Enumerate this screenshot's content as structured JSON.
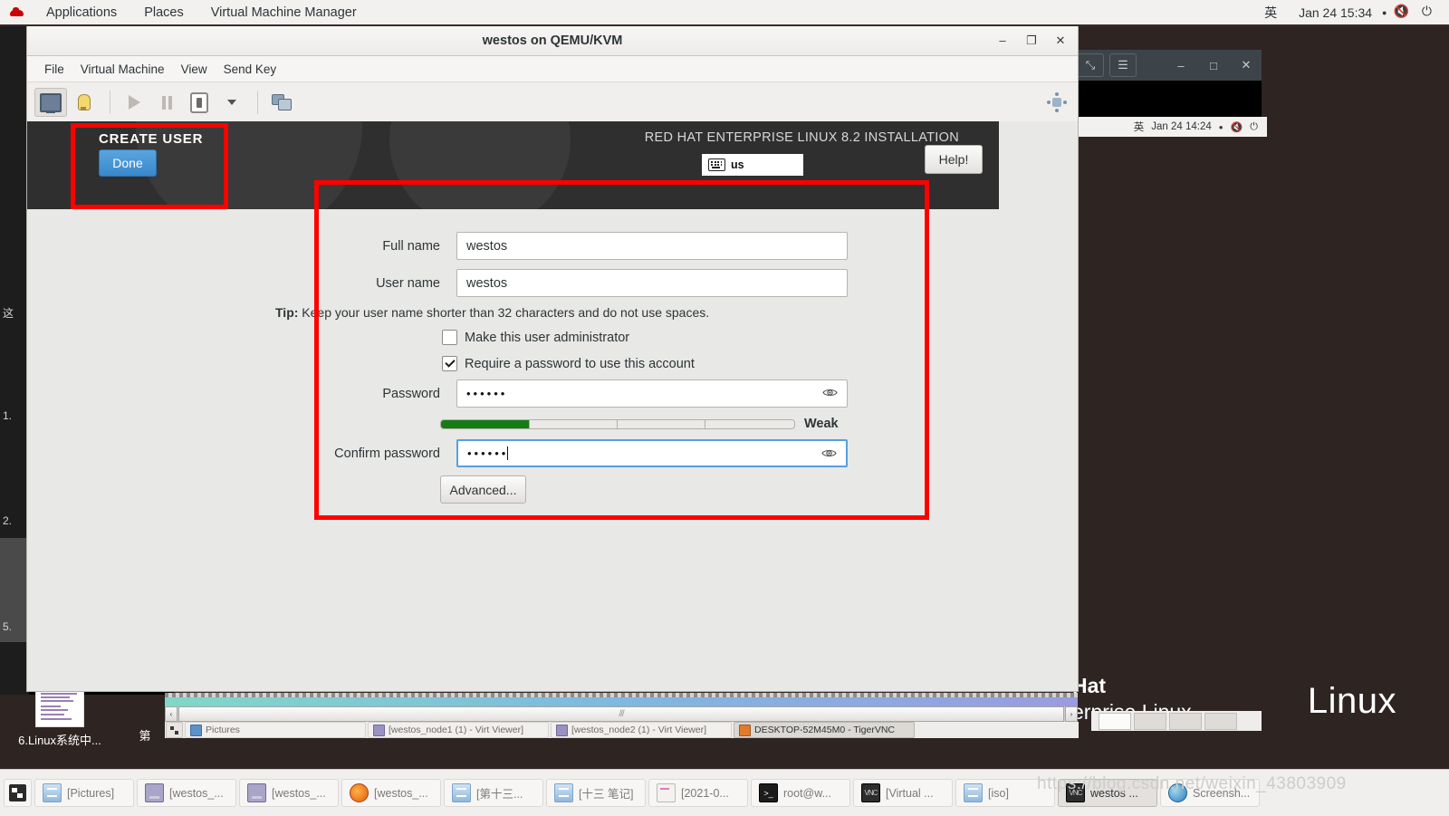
{
  "gnome_topbar": {
    "logo_icon": "red-hat-logo-icon",
    "items": [
      "Applications",
      "Places",
      "Virtual Machine Manager"
    ],
    "ime": "英",
    "clock": "Jan 24  15:34",
    "clock_dot": "●",
    "volume_icon": "volume-muted-icon",
    "power_icon": "power-icon"
  },
  "background_window": {
    "buttons": [
      "fullscreen-icon",
      "menu-icon",
      "minimize-icon",
      "maximize-icon",
      "close-icon"
    ],
    "fullscreen_glyph": "⤡",
    "menu_glyph": "☰",
    "minimize_glyph": "–",
    "maximize_glyph": "□",
    "close_glyph": "✕",
    "gnome_ime": "英",
    "gnome_clock": "Jan 24 14:24",
    "gnome_dot": "●",
    "gnome_volume": "🔇",
    "gnome_power": "⏻",
    "brand_line1": "Hat",
    "brand_line2": "erprise Linux"
  },
  "desktop": {
    "wallpaper_text": "Linux",
    "icons": [
      {
        "label": "6.Linux系统中..."
      },
      {
        "label": "第"
      }
    ]
  },
  "left_doc_panel": {
    "rows": [
      "这",
      "1.",
      "2.",
      "5."
    ]
  },
  "vm_window": {
    "title": "westos on QEMU/KVM",
    "window_buttons": {
      "minimize": "–",
      "maximize": "❐",
      "close": "✕"
    },
    "menus": [
      "File",
      "Virtual Machine",
      "View",
      "Send Key"
    ],
    "toolbar": [
      {
        "name": "console-view-button",
        "icon": "monitor-icon"
      },
      {
        "name": "details-view-button",
        "icon": "lightbulb-icon"
      },
      {
        "name": "run-button",
        "icon": "play-icon"
      },
      {
        "name": "pause-button",
        "icon": "pause-icon"
      },
      {
        "name": "shutdown-button",
        "icon": "power-off-icon"
      },
      {
        "name": "shutdown-menu-button",
        "icon": "chevron-down-icon"
      },
      {
        "name": "snapshots-button",
        "icon": "screens-icon"
      },
      {
        "name": "fullscreen-toggle",
        "icon": "expand-dots-icon"
      }
    ]
  },
  "installer": {
    "spoke_title": "CREATE USER",
    "done_label": "Done",
    "product_title": "RED HAT ENTERPRISE LINUX 8.2 INSTALLATION",
    "keyboard_layout": "us",
    "keyboard_icon": "keyboard-icon",
    "help_label": "Help!",
    "fields": {
      "full_name_label": "Full name",
      "full_name_value": "westos",
      "user_name_label": "User name",
      "user_name_value": "westos",
      "tip_bold": "Tip:",
      "tip_text": " Keep your user name shorter than 32 characters and do not use spaces.",
      "admin_checkbox_label": "Make this user administrator",
      "admin_checked": false,
      "require_password_label": "Require a password to use this account",
      "require_password_checked": true,
      "password_label": "Password",
      "password_value": "••••••",
      "confirm_label": "Confirm password",
      "confirm_value": "••••••",
      "reveal_icon": "eye-icon",
      "strength_label": "Weak",
      "strength_percent": 25,
      "strength_color": "#157c15",
      "advanced_label": "Advanced..."
    }
  },
  "inner_taskbar": {
    "start_icon": "show-desktop-icon",
    "items": [
      {
        "label": "Pictures",
        "icon": "folder-icon",
        "selected": false
      },
      {
        "label": "[westos_node1 (1) - Virt Viewer]",
        "icon": "viewer-icon",
        "selected": false
      },
      {
        "label": "[westos_node2 (1) - Virt Viewer]",
        "icon": "viewer-icon",
        "selected": false
      },
      {
        "label": "DESKTOP-52M45M0 - TigerVNC",
        "icon": "vnc-icon",
        "selected": true
      }
    ],
    "scroll_thumb_glyph": "///",
    "scroll_left_glyph": "‹",
    "scroll_right_glyph": "›"
  },
  "windows_taskbar": {
    "show_desktop_icon": "show-desktop-icon",
    "items": [
      {
        "label": "[Pictures]",
        "icon": "drive-icon",
        "selected": false
      },
      {
        "label": "[westos_...",
        "icon": "monitor-icon",
        "selected": false
      },
      {
        "label": "[westos_...",
        "icon": "monitor-icon",
        "selected": false
      },
      {
        "label": "[westos_...",
        "icon": "firefox-icon",
        "selected": false
      },
      {
        "label": "[第十三...",
        "icon": "drive-icon",
        "selected": false
      },
      {
        "label": "[十三 笔记]",
        "icon": "drive-icon",
        "selected": false
      },
      {
        "label": "[2021-0...",
        "icon": "note-icon",
        "selected": false
      },
      {
        "label": "root@w...",
        "icon": "terminal-icon",
        "selected": false
      },
      {
        "label": "[Virtual ...",
        "icon": "vnc-icon",
        "selected": false
      },
      {
        "label": "[iso]",
        "icon": "drive-icon",
        "selected": false
      },
      {
        "label": "westos ...",
        "icon": "vnc-icon",
        "selected": true
      },
      {
        "label": "Screensh...",
        "icon": "screenshot-icon",
        "selected": false
      }
    ]
  },
  "watermark": "https://blog.csdn.net/weixin_43803909"
}
